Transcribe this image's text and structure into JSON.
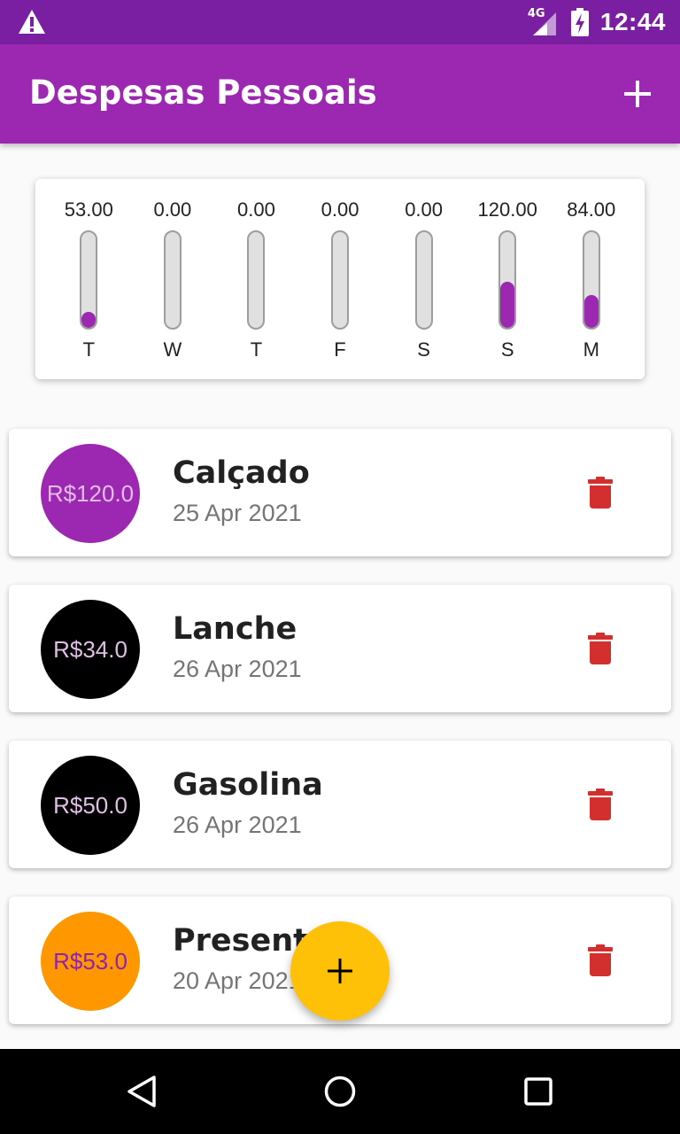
{
  "status_bar": {
    "time": "12:44",
    "network": "4G",
    "icons": [
      "warning-icon",
      "signal-icon",
      "battery-charging-icon"
    ]
  },
  "app_bar": {
    "title": "Despesas Pessoais",
    "add_icon": "plus-icon"
  },
  "chart_data": {
    "type": "bar",
    "categories": [
      "T",
      "W",
      "T",
      "F",
      "S",
      "S",
      "M"
    ],
    "value_labels": [
      "53.00",
      "0.00",
      "0.00",
      "0.00",
      "0.00",
      "120.00",
      "84.00"
    ],
    "values": [
      53.0,
      0.0,
      0.0,
      0.0,
      0.0,
      120.0,
      84.0
    ],
    "fill_fractions": [
      0.17,
      0.0,
      0.0,
      0.0,
      0.0,
      0.48,
      0.34
    ],
    "bar_color": "#9c27b0"
  },
  "transactions": [
    {
      "title": "Calçado",
      "date": "25 Apr 2021",
      "amount": "R$120.0",
      "avatar_color": "#9c27b0",
      "amount_color": "#e1bee7",
      "delete_icon": "trash-icon"
    },
    {
      "title": "Lanche",
      "date": "26 Apr 2021",
      "amount": "R$34.0",
      "avatar_color": "#000000",
      "amount_color": "#e1bee7",
      "delete_icon": "trash-icon"
    },
    {
      "title": "Gasolina",
      "date": "26 Apr 2021",
      "amount": "R$50.0",
      "avatar_color": "#000000",
      "amount_color": "#e1bee7",
      "delete_icon": "trash-icon"
    },
    {
      "title": "Presente",
      "date": "20 Apr 2021",
      "amount": "R$53.0",
      "avatar_color": "#ff9800",
      "amount_color": "#8e24aa",
      "delete_icon": "trash-icon"
    }
  ],
  "fab": {
    "icon": "plus-icon",
    "color": "#ffc107"
  },
  "nav_bar": {
    "icons": [
      "back-icon",
      "home-icon",
      "recents-icon"
    ]
  },
  "colors": {
    "primary": "#9c27b0",
    "primary_dark": "#7b1fa2",
    "accent": "#ffc107",
    "delete": "#d32f2f"
  }
}
